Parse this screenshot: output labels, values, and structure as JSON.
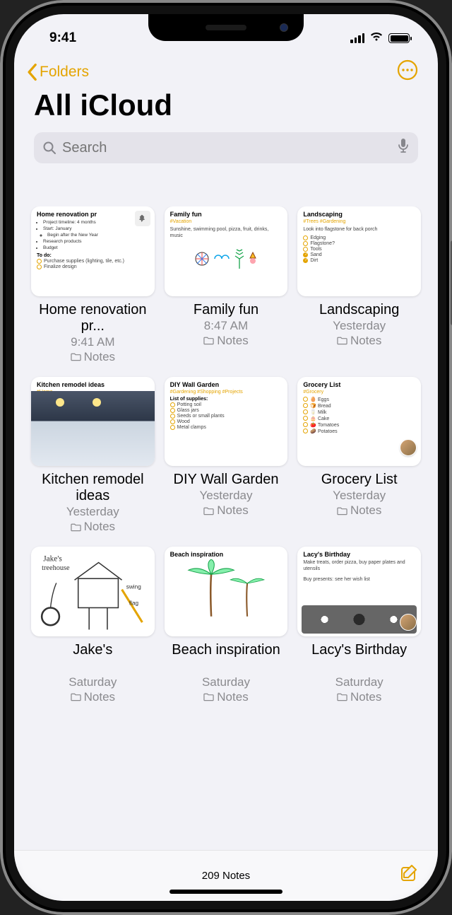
{
  "status": {
    "time": "9:41"
  },
  "nav": {
    "back_label": "Folders"
  },
  "header": {
    "title": "All iCloud"
  },
  "search": {
    "placeholder": "Search"
  },
  "toolbar": {
    "count_label": "209 Notes"
  },
  "notes": [
    {
      "title": "Home renovation pr...",
      "time": "9:41 AM",
      "folder": "Notes",
      "thumb_title": "Home renovation pr",
      "pinned": true,
      "bullets": [
        "Project timeline: 4 months",
        "Start: January",
        "Begin after the New Year",
        "Research products",
        "Budget"
      ],
      "sub": "To do:",
      "checks": [
        {
          "label": "Purchase supplies (lighting, tile, etc.)",
          "on": false
        },
        {
          "label": "Finalize design",
          "on": false
        }
      ]
    },
    {
      "title": "Family fun",
      "time": "8:47 AM",
      "folder": "Notes",
      "thumb_title": "Family fun",
      "tag": "#Vacation",
      "body": "Sunshine, swimming pool, pizza, fruit, drinks, music"
    },
    {
      "title": "Landscaping",
      "time": "Yesterday",
      "folder": "Notes",
      "thumb_title": "Landscaping",
      "tag": "#Trees #Gardening",
      "body": "Look into flagstone for back porch",
      "checks": [
        {
          "label": "Edging",
          "on": false
        },
        {
          "label": "Flagstone?",
          "on": false
        },
        {
          "label": "Tools",
          "on": false
        },
        {
          "label": "Sand",
          "on": true
        },
        {
          "label": "Dirt",
          "on": true
        }
      ]
    },
    {
      "title": "Kitchen remodel ideas",
      "time": "Yesterday",
      "folder": "Notes",
      "thumb_title": "Kitchen remodel ideas",
      "tag": "#Home"
    },
    {
      "title": "DIY Wall Garden",
      "time": "Yesterday",
      "folder": "Notes",
      "thumb_title": "DIY Wall Garden",
      "tag": "#Gardening #Shopping #Projects",
      "sub": "List of supplies:",
      "checks": [
        {
          "label": "Potting soil",
          "on": false
        },
        {
          "label": "Glass jars",
          "on": false
        },
        {
          "label": "Seeds or small plants",
          "on": false
        },
        {
          "label": "Wood",
          "on": false
        },
        {
          "label": "Metal clamps",
          "on": false
        }
      ]
    },
    {
      "title": "Grocery List",
      "time": "Yesterday",
      "folder": "Notes",
      "thumb_title": "Grocery List",
      "tag": "#Grocery",
      "shared": true,
      "checks": [
        {
          "label": "🥚 Eggs",
          "on": false
        },
        {
          "label": "🍞 Bread",
          "on": false
        },
        {
          "label": "🥛 Milk",
          "on": false
        },
        {
          "label": "🎂 Cake",
          "on": false
        },
        {
          "label": "🍅 Tomatoes",
          "on": false
        },
        {
          "label": "🥔 Potatoes",
          "on": false
        }
      ]
    },
    {
      "title": "Jake's",
      "time": "Saturday",
      "folder": "Notes"
    },
    {
      "title": "Beach inspiration",
      "time": "Saturday",
      "folder": "Notes",
      "thumb_title": "Beach inspiration"
    },
    {
      "title": "Lacy's Birthday",
      "time": "Saturday",
      "folder": "Notes",
      "thumb_title": "Lacy's Birthday",
      "body": "Make treats, order pizza, buy paper plates and utensils",
      "body2": "Buy presents: see her wish list",
      "shared": true
    }
  ]
}
